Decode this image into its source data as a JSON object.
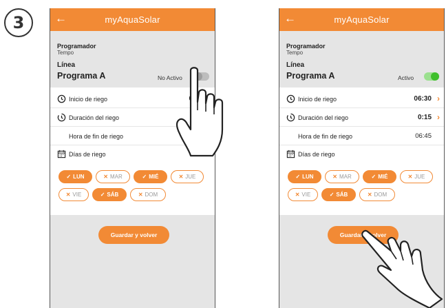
{
  "step_number": "3",
  "header": {
    "back_icon": "arrow-left-icon",
    "title": "myAquaSolar"
  },
  "colors": {
    "accent": "#f28a35",
    "toggle_on": "#3fbf2c",
    "toggle_off": "#9e9e9e"
  },
  "left": {
    "programador_label": "Programador",
    "programador_value": "Tempo",
    "linea_label": "Línea",
    "programa_name": "Programa A",
    "status": "No Activo",
    "rows": {
      "inicio_label": "Inicio de riego",
      "inicio_value": "0",
      "duracion_label": "Duración del riego",
      "fin_label": "Hora de fin de riego",
      "dias_label": "Días de riego"
    },
    "days": [
      {
        "label": "LUN",
        "selected": true
      },
      {
        "label": "MAR",
        "selected": false
      },
      {
        "label": "MIÉ",
        "selected": true
      },
      {
        "label": "JUE",
        "selected": false
      },
      {
        "label": "VIE",
        "selected": false
      },
      {
        "label": "SÁB",
        "selected": true
      },
      {
        "label": "DOM",
        "selected": false
      }
    ],
    "save_label": "Guardar y volver"
  },
  "right": {
    "programador_label": "Programador",
    "programador_value": "Tempo",
    "linea_label": "Línea",
    "programa_name": "Programa A",
    "status": "Activo",
    "rows": {
      "inicio_label": "Inicio de riego",
      "inicio_value": "06:30",
      "duracion_label": "Duración del riego",
      "duracion_value": "0:15",
      "fin_label": "Hora de fin de riego",
      "fin_value": "06:45",
      "dias_label": "Días de riego"
    },
    "days": [
      {
        "label": "LUN",
        "selected": true
      },
      {
        "label": "MAR",
        "selected": false
      },
      {
        "label": "MIÉ",
        "selected": true
      },
      {
        "label": "JUE",
        "selected": false
      },
      {
        "label": "VIE",
        "selected": false
      },
      {
        "label": "SÁB",
        "selected": true
      },
      {
        "label": "DOM",
        "selected": false
      }
    ],
    "save_label": "Guardar y volver"
  }
}
